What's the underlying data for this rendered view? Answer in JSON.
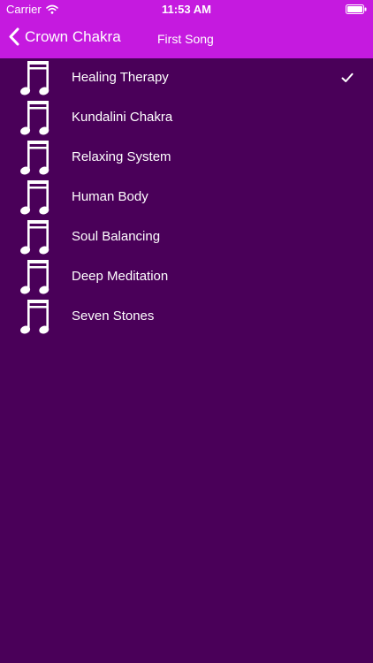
{
  "status_bar": {
    "carrier": "Carrier",
    "time": "11:53 AM",
    "wifi_icon": "wifi-icon",
    "battery_icon": "battery-icon"
  },
  "nav": {
    "back_label": "Crown Chakra",
    "back_icon": "chevron-left-icon",
    "title": "First Song"
  },
  "songs": [
    {
      "title": "Healing Therapy",
      "icon": "music-note-icon",
      "selected": true
    },
    {
      "title": "Kundalini Chakra",
      "icon": "music-note-icon",
      "selected": false
    },
    {
      "title": "Relaxing System",
      "icon": "music-note-icon",
      "selected": false
    },
    {
      "title": "Human Body",
      "icon": "music-note-icon",
      "selected": false
    },
    {
      "title": "Soul Balancing",
      "icon": "music-note-icon",
      "selected": false
    },
    {
      "title": "Deep Meditation",
      "icon": "music-note-icon",
      "selected": false
    },
    {
      "title": "Seven Stones",
      "icon": "music-note-icon",
      "selected": false
    }
  ],
  "colors": {
    "header_background": "#c51adf",
    "list_background": "#4a0059",
    "text": "#ffffff"
  }
}
